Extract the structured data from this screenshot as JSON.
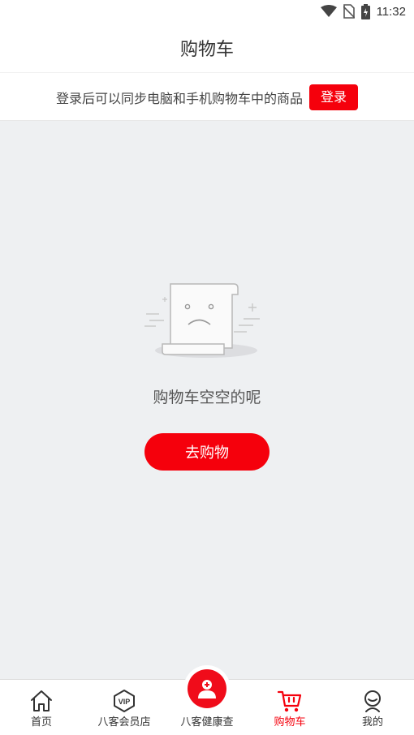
{
  "status_bar": {
    "time": "11:32"
  },
  "header": {
    "title": "购物车"
  },
  "login_banner": {
    "tip": "登录后可以同步电脑和手机购物车中的商品",
    "button_label": "登录"
  },
  "empty_state": {
    "message": "购物车空空的呢",
    "button_label": "去购物"
  },
  "tab_bar": {
    "tabs": [
      {
        "label": "首页",
        "icon": "home-icon"
      },
      {
        "label": "八客会员店",
        "icon": "vip-icon"
      },
      {
        "label": "八客健康查",
        "icon": "health-icon"
      },
      {
        "label": "购物车",
        "icon": "cart-icon",
        "active": true
      },
      {
        "label": "我的",
        "icon": "profile-icon"
      }
    ]
  },
  "colors": {
    "accent": "#f5000c",
    "background": "#eef0f2"
  }
}
